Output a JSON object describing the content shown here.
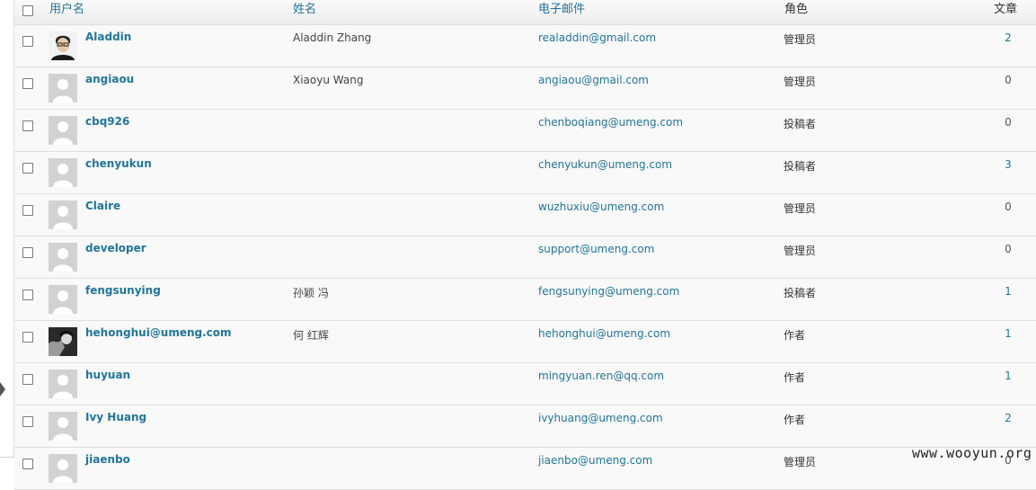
{
  "columns": {
    "username": "用户名",
    "name": "姓名",
    "email": "电子邮件",
    "role": "角色",
    "posts": "文章"
  },
  "users": [
    {
      "username": "Aladdin",
      "name": "Aladdin Zhang",
      "email": "realaddin@gmail.com",
      "role": "管理员",
      "posts": "2",
      "avatar": "photo-man"
    },
    {
      "username": "angiaou",
      "name": "Xiaoyu Wang",
      "email": "angiaou@gmail.com",
      "role": "管理员",
      "posts": "0",
      "avatar": "default-avatar"
    },
    {
      "username": "cbq926",
      "name": "",
      "email": "chenboqiang@umeng.com",
      "role": "投稿者",
      "posts": "0",
      "avatar": "default-avatar"
    },
    {
      "username": "chenyukun",
      "name": "",
      "email": "chenyukun@umeng.com",
      "role": "投稿者",
      "posts": "3",
      "avatar": "default-avatar"
    },
    {
      "username": "Claire",
      "name": "",
      "email": "wuzhuxiu@umeng.com",
      "role": "管理员",
      "posts": "0",
      "avatar": "default-avatar"
    },
    {
      "username": "developer",
      "name": "",
      "email": "support@umeng.com",
      "role": "管理员",
      "posts": "0",
      "avatar": "default-avatar"
    },
    {
      "username": "fengsunying",
      "name": "孙颖 冯",
      "email": "fengsunying@umeng.com",
      "role": "投稿者",
      "posts": "1",
      "avatar": "default-avatar"
    },
    {
      "username": "hehonghui@umeng.com",
      "name": "何 红辉",
      "email": "hehonghui@umeng.com",
      "role": "作者",
      "posts": "1",
      "avatar": "photo-dark"
    },
    {
      "username": "huyuan",
      "name": "",
      "email": "mingyuan.ren@qq.com",
      "role": "作者",
      "posts": "1",
      "avatar": "default-avatar"
    },
    {
      "username": "Ivy Huang",
      "name": "",
      "email": "ivyhuang@umeng.com",
      "role": "作者",
      "posts": "2",
      "avatar": "default-avatar"
    },
    {
      "username": "jiaenbo",
      "name": "",
      "email": "jiaenbo@umeng.com",
      "role": "管理员",
      "posts": "0",
      "avatar": "default-avatar"
    }
  ],
  "watermark": "www.wooyun.org",
  "colors": {
    "link": "#21759b",
    "header_bg": "#ececec",
    "row_bg": "#f9f9f9",
    "border": "#dfdfdf"
  }
}
